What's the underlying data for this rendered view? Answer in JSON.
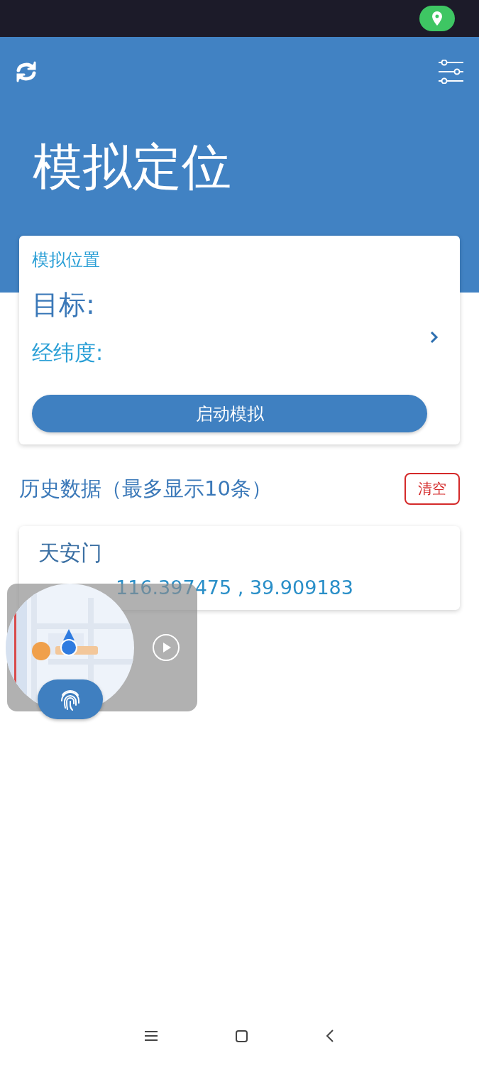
{
  "header": {
    "title": "模拟定位"
  },
  "location_card": {
    "title": "模拟位置",
    "target_label": "目标:",
    "coords_label": "经纬度:",
    "button": "启动模拟"
  },
  "history": {
    "title": "历史数据（最多显示10条）",
    "clear_button": "清空",
    "items": [
      {
        "name": "天安门",
        "coords": "116.397475 , 39.909183"
      }
    ]
  }
}
